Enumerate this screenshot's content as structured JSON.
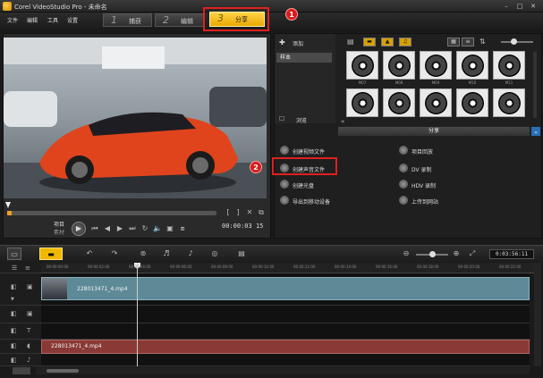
{
  "window": {
    "title": "Corel VideoStudio Pro - 未命名",
    "controls": [
      "–",
      "□",
      "✕"
    ]
  },
  "menu": [
    "文件",
    "编辑",
    "工具",
    "设置"
  ],
  "steps": [
    {
      "num": "1",
      "label": "捕获"
    },
    {
      "num": "2",
      "label": "编辑"
    },
    {
      "num": "3",
      "label": "分享"
    }
  ],
  "callouts": [
    "1",
    "2"
  ],
  "player": {
    "timecode": "00:00:03",
    "timecode_suffix": "15",
    "project_label": "项目",
    "clip_label": "素材",
    "progress": 0.02
  },
  "library": {
    "add_label": "添加",
    "category": "样本",
    "browse_label": "浏览",
    "thumbs_row1": [
      "M07",
      "M08",
      "M09",
      "M10",
      "M11"
    ],
    "share_header": "分享",
    "share_left": [
      "创建视频文件",
      "创建声音文件",
      "创建光盘",
      "导出到移动设备"
    ],
    "share_right": [
      "项目回放",
      "DV 录制",
      "HDV 录制",
      "上传到网站"
    ]
  },
  "timeline": {
    "timecode": "0:03:56:11",
    "ruler_ticks": [
      "00:00:00:00",
      "00:00:02:00",
      "00:00:04:00",
      "00:00:06:00",
      "00:00:08:00",
      "00:00:10:00",
      "00:00:12:00",
      "00:00:14:00",
      "00:00:16:00",
      "00:00:18:00",
      "00:00:20:00",
      "00:00:22:00"
    ],
    "video_clip": "228013471_4.mp4",
    "audio_clip": "228013471_4.mp4"
  },
  "colors": {
    "active_step": "#f0b800",
    "callout": "#d81c1c",
    "video_clip": "#5e8a98",
    "audio_clip": "#8a3a36"
  }
}
